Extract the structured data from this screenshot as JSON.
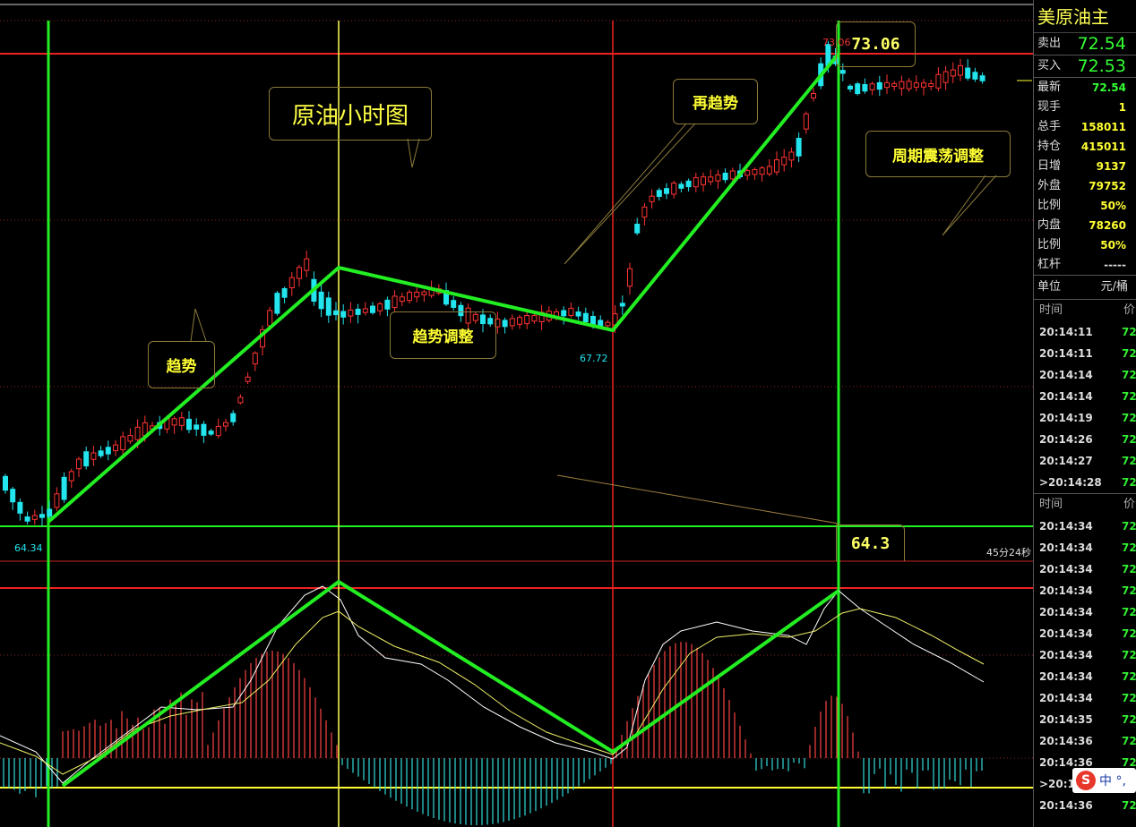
{
  "chart": {
    "price_labels": {
      "high": "73.06",
      "low": "64.34",
      "mid_low": "67.72"
    },
    "timer": "45分24秒",
    "annotations": {
      "title": "原油小时图",
      "trend1": "趋势",
      "adjust": "趋势调整",
      "trend2": "再趋势",
      "cycle": "周期震荡调整"
    },
    "price_boxes": {
      "top": "73.06",
      "bottom": "64.3"
    },
    "colors": {
      "green": "#22ee22",
      "red": "#ee2222",
      "yellow": "#ffff66",
      "up": "#ff3333",
      "down": "#22e5ee"
    }
  },
  "sidebar": {
    "title": "美原油主",
    "sell_label": "卖出",
    "sell_value": "72.54",
    "buy_label": "买入",
    "buy_value": "72.53",
    "stats": [
      {
        "label": "最新",
        "value": "72.54",
        "color": "#33ff33"
      },
      {
        "label": "现手",
        "value": "1",
        "color": "#ffff33"
      },
      {
        "label": "总手",
        "value": "158011",
        "color": "#ffff33"
      },
      {
        "label": "持仓",
        "value": "415011",
        "color": "#ffff33"
      },
      {
        "label": "日增",
        "value": "9137",
        "color": "#ffff33"
      },
      {
        "label": "外盘",
        "value": "79752",
        "color": "#ffff33"
      },
      {
        "label": "比例",
        "value": "50%",
        "color": "#ffff33"
      },
      {
        "label": "内盘",
        "value": "78260",
        "color": "#ffff33"
      },
      {
        "label": "比例",
        "value": "50%",
        "color": "#ffff33"
      },
      {
        "label": "杠杆",
        "value": "-----",
        "color": "#ddd"
      }
    ],
    "unit_label": "单位",
    "unit_value": "元/桶",
    "ticks_header": {
      "time": "时间",
      "price": "价"
    },
    "ticks1": [
      {
        "time": "20:14:11",
        "price": "72"
      },
      {
        "time": "20:14:11",
        "price": "72"
      },
      {
        "time": "20:14:14",
        "price": "72"
      },
      {
        "time": "20:14:14",
        "price": "72"
      },
      {
        "time": "20:14:19",
        "price": "72"
      },
      {
        "time": "20:14:26",
        "price": "72"
      },
      {
        "time": "20:14:27",
        "price": "72"
      },
      {
        "time": ">20:14:28",
        "price": "72"
      }
    ],
    "ticks2": [
      {
        "time": "20:14:34",
        "price": "72"
      },
      {
        "time": "20:14:34",
        "price": "72"
      },
      {
        "time": "20:14:34",
        "price": "72"
      },
      {
        "time": "20:14:34",
        "price": "72"
      },
      {
        "time": "20:14:34",
        "price": "72"
      },
      {
        "time": "20:14:34",
        "price": "72"
      },
      {
        "time": "20:14:34",
        "price": "72"
      },
      {
        "time": "20:14:34",
        "price": "72"
      },
      {
        "time": "20:14:34",
        "price": "72"
      },
      {
        "time": "20:14:35",
        "price": "72"
      },
      {
        "time": "20:14:36",
        "price": "72"
      },
      {
        "time": "20:14:36",
        "price": "72"
      },
      {
        "time": ">20:14:36",
        "price": "72"
      },
      {
        "time": "20:14:36",
        "price": "72"
      }
    ],
    "ime": {
      "logo": "S",
      "text": "中 °,"
    }
  }
}
